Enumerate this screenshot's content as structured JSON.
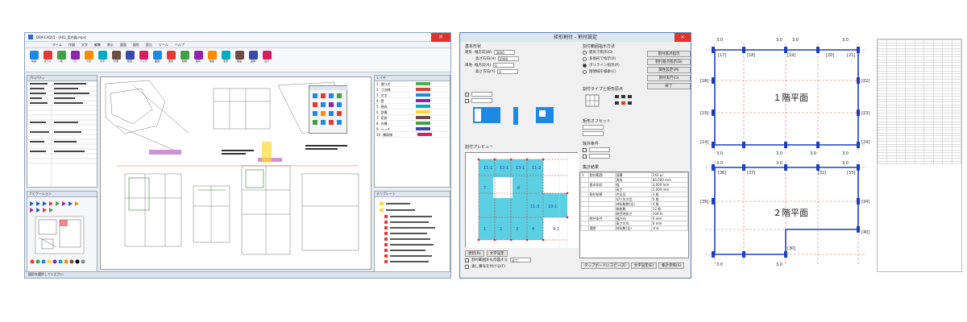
{
  "cad": {
    "title": "DRA-CAD15 - [A01_案内図.mps]",
    "menu": [
      "ホーム",
      "作図",
      "文字",
      "編集",
      "表示",
      "図面",
      "図形",
      "読込",
      "ツール",
      "ヘルプ"
    ],
    "ribbon": [
      "拡張",
      "ダブル",
      "線",
      "円",
      "寸法",
      "文字",
      "計測",
      "配置",
      "ハッチ",
      "面積",
      "属性",
      "移動",
      "複写",
      "削除",
      "変形",
      "部品",
      "画像",
      "出力"
    ],
    "left_header": "プロパティ",
    "left2_header": "ナビゲーション",
    "right_header": "レイヤ",
    "right2_header": "テンプレート",
    "layers": [
      {
        "no": "1",
        "name": "通り芯",
        "color": "#4caf50"
      },
      {
        "no": "2",
        "name": "寸法線",
        "color": "#e53935"
      },
      {
        "no": "3",
        "name": "文字",
        "color": "#1e88e5"
      },
      {
        "no": "4",
        "name": "壁",
        "color": "#8e24aa"
      },
      {
        "no": "5",
        "name": "建具",
        "color": "#00acc1"
      },
      {
        "no": "6",
        "name": "設備",
        "color": "#fdd835"
      },
      {
        "no": "7",
        "name": "家具",
        "color": "#6d4c41"
      },
      {
        "no": "8",
        "name": "外構",
        "color": "#43a047"
      },
      {
        "no": "9",
        "name": "ハッチ",
        "color": "#3949ab"
      },
      {
        "no": "10",
        "name": "補助線",
        "color": "#d81b60"
      }
    ],
    "status": "図形を選択してください"
  },
  "dialog": {
    "title": "矩形割付 - 割付設定",
    "basic": "基本形状",
    "rect_label": "矩形",
    "width_label": "幅方向(W)",
    "height_label": "高さ方向(H)",
    "width_val": "3000",
    "height_val": "2000",
    "grid_label": "目地",
    "grid_w_label": "幅方向(X)",
    "grid_h_label": "高さ方向(Y)",
    "grid_val": "0",
    "method_title": "割付範囲指示方法",
    "methods": [
      "矩形で指示(O)",
      "多角形で指示(P)",
      "ポリライン指示(P)",
      "閉領域を検索(C)"
    ],
    "type_title": "割付タイプと矩形原点",
    "offset_title": "矩形オフセット",
    "exclude_title": "除外条件",
    "preview_title": "割付プレビュー",
    "result_title": "集計結果",
    "result_rows": [
      [
        "1",
        "割付範囲",
        "面積",
        "243 ㎡"
      ],
      [
        "",
        "",
        "周長",
        "84,000 mm"
      ],
      [
        "",
        "基本形状",
        "幅",
        "3,000 mm"
      ],
      [
        "",
        "",
        "高さ",
        "2,000 mm"
      ],
      [
        "",
        "割付結果",
        "完全品",
        "3 枚"
      ],
      [
        "",
        "",
        "切り欠き品",
        "5 枚"
      ],
      [
        "",
        "",
        "材料枚数(全)",
        "4 枚"
      ],
      [
        "",
        "",
        "総枚数",
        "12 枚"
      ],
      [
        "",
        "",
        "総目地長さ",
        "104 m"
      ],
      [
        "",
        "除外条件",
        "幅方向",
        "0 mm"
      ],
      [
        "",
        "",
        "高さ方向",
        "0 mm"
      ],
      [
        "",
        "通常",
        "材料数(全)",
        "する"
      ]
    ],
    "buttons": [
      "割付基点指示",
      "割付基点指示(B)",
      "属性設定(M)",
      "割付実行(G)",
      "終了"
    ],
    "bottom_buttons": [
      "タップボードにコピー(Z)",
      "文字設定(E)",
      "集計参照(S)"
    ],
    "update": "更新(R)",
    "text_set": "文字設定",
    "combo": "全て",
    "opt_cut": "割付範囲外も作図する",
    "opt_num": "通し番号を付ける(F)"
  },
  "plan": {
    "floor1": "１階平面",
    "floor2": "２階平面",
    "dims": [
      "3.0",
      "3.0",
      "3.0",
      "3.0",
      "3.0",
      "3.0",
      "3.0",
      "3.0",
      "3.0",
      "3.0",
      "3.0",
      "3.0",
      "3.0",
      "3.0",
      "3.0",
      "3.0"
    ]
  },
  "sheet": {
    "rows": 44,
    "cols": 9
  }
}
